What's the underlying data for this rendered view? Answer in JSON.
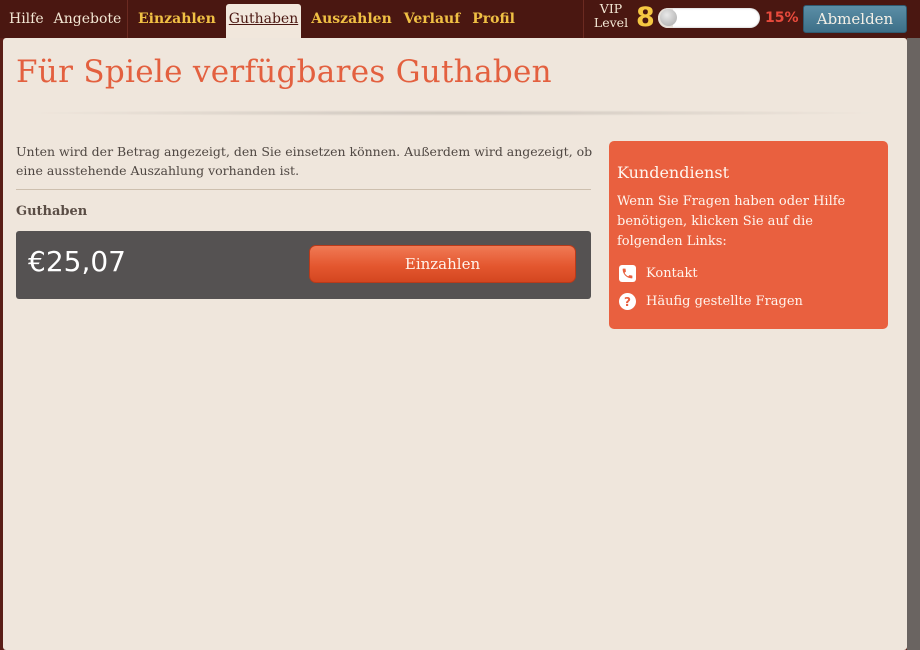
{
  "topbar": {
    "left_links": [
      "Hilfe",
      "Angebote"
    ],
    "main_links": [
      "Einzahlen",
      "Guthaben",
      "Auszahlen",
      "Verlauf",
      "Profil"
    ],
    "active_link": "Guthaben",
    "vip_label_line1": "VIP",
    "vip_label_line2": "Level",
    "vip_level": "8",
    "progress_percent": "15%",
    "progress_value": 0.15,
    "logout_label": "Abmelden"
  },
  "main": {
    "title": "Für Spiele verfügbares Guthaben",
    "intro": "Unten wird der Betrag angezeigt, den Sie einsetzen können. Außerdem wird angezeigt, ob eine ausstehende Auszahlung vorhanden ist.",
    "balance_label": "Guthaben",
    "balance_amount": "€25,07",
    "deposit_button": "Einzahlen"
  },
  "support": {
    "title": "Kundendienst",
    "text": "Wenn Sie Fragen haben oder Hilfe benötigen, klicken Sie auf die folgenden Links:",
    "links": [
      {
        "label": "Kontakt",
        "icon": "phone-icon"
      },
      {
        "label": "Häufig gestellte Fragen",
        "icon": "question-icon"
      }
    ]
  },
  "colors": {
    "topbar": "#4a1711",
    "nav_link": "#f0c044",
    "accent": "#e3603f",
    "panel": "#efe6dc",
    "balance_box": "#555252",
    "support_card": "#e9603f",
    "logout_button": "#4a7d96"
  }
}
